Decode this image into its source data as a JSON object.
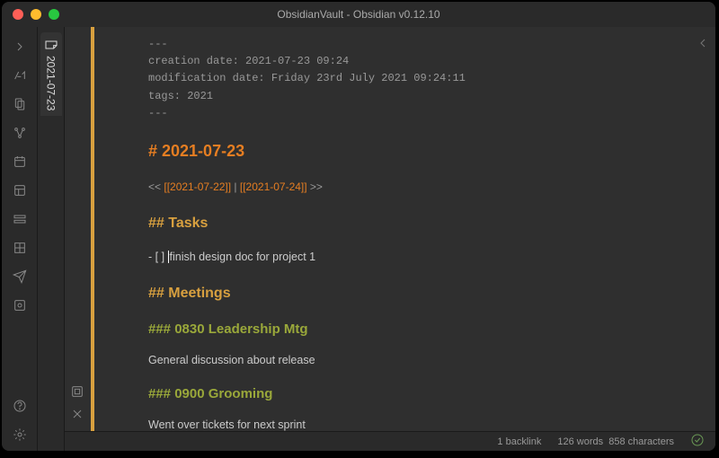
{
  "titlebar": {
    "title": "ObsidianVault - Obsidian v0.12.10"
  },
  "tab": {
    "label": "2021-07-23"
  },
  "frontmatter": {
    "delim": "---",
    "creation": "creation date: 2021-07-23 09:24",
    "modification": "modification date: Friday 23rd July 2021 09:24:11",
    "tags": "tags: 2021"
  },
  "content": {
    "h1_hash": "#",
    "h1_text": " 2021-07-23",
    "nav_pre": "<< ",
    "nav_link1": "[[2021-07-22]]",
    "nav_sep": " | ",
    "nav_link2": "[[2021-07-24]]",
    "nav_post": " >>",
    "tasks_hash": "##",
    "tasks_text": " Tasks",
    "task1_prefix": "- [  ] ",
    "task1_text": "finish design doc for project 1",
    "meetings_hash": "##",
    "meetings_text": " Meetings",
    "meeting1_hash": "###",
    "meeting1_text": " 0830 Leadership Mtg",
    "meeting1_body": "General discussion about release",
    "meeting2_hash": "###",
    "meeting2_text": " 0900 Grooming",
    "meeting2_body": "Went over tickets for next sprint"
  },
  "statusbar": {
    "backlinks": "1 backlink",
    "words": "126 words",
    "chars": "858 characters"
  }
}
